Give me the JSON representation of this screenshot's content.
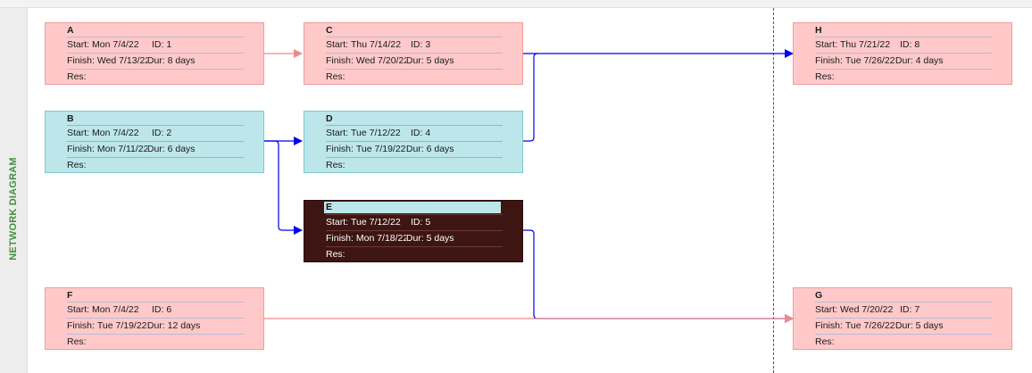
{
  "sidebar": {
    "label": "NETWORK DIAGRAM"
  },
  "labels": {
    "start": "Start:",
    "id": "ID:",
    "finish": "Finish:",
    "dur": "Dur:",
    "res": "Res:"
  },
  "tasks": {
    "A": {
      "name": "A",
      "start": "Mon 7/4/22",
      "id": "1",
      "finish": "Wed 7/13/22",
      "dur": "8 days",
      "res": ""
    },
    "B": {
      "name": "B",
      "start": "Mon 7/4/22",
      "id": "2",
      "finish": "Mon 7/11/22",
      "dur": "6 days",
      "res": ""
    },
    "C": {
      "name": "C",
      "start": "Thu 7/14/22",
      "id": "3",
      "finish": "Wed 7/20/22",
      "dur": "5 days",
      "res": ""
    },
    "D": {
      "name": "D",
      "start": "Tue 7/12/22",
      "id": "4",
      "finish": "Tue 7/19/22",
      "dur": "6 days",
      "res": ""
    },
    "E": {
      "name": "E",
      "start": "Tue 7/12/22",
      "id": "5",
      "finish": "Mon 7/18/22",
      "dur": "5 days",
      "res": ""
    },
    "F": {
      "name": "F",
      "start": "Mon 7/4/22",
      "id": "6",
      "finish": "Tue 7/19/22",
      "dur": "12 days",
      "res": ""
    },
    "G": {
      "name": "G",
      "start": "Wed 7/20/22",
      "id": "7",
      "finish": "Tue 7/26/22",
      "dur": "5 days",
      "res": ""
    },
    "H": {
      "name": "H",
      "start": "Thu 7/21/22",
      "id": "8",
      "finish": "Tue 7/26/22",
      "dur": "4 days",
      "res": ""
    }
  },
  "colors": {
    "critical_fill": "#ffc9c9",
    "noncritical_fill": "#bde6ea",
    "selected_fill": "#3d1512",
    "critical_link": "#f08a8a",
    "noncritical_link": "#0000ee",
    "sidebar_text": "#3f8f3f"
  }
}
